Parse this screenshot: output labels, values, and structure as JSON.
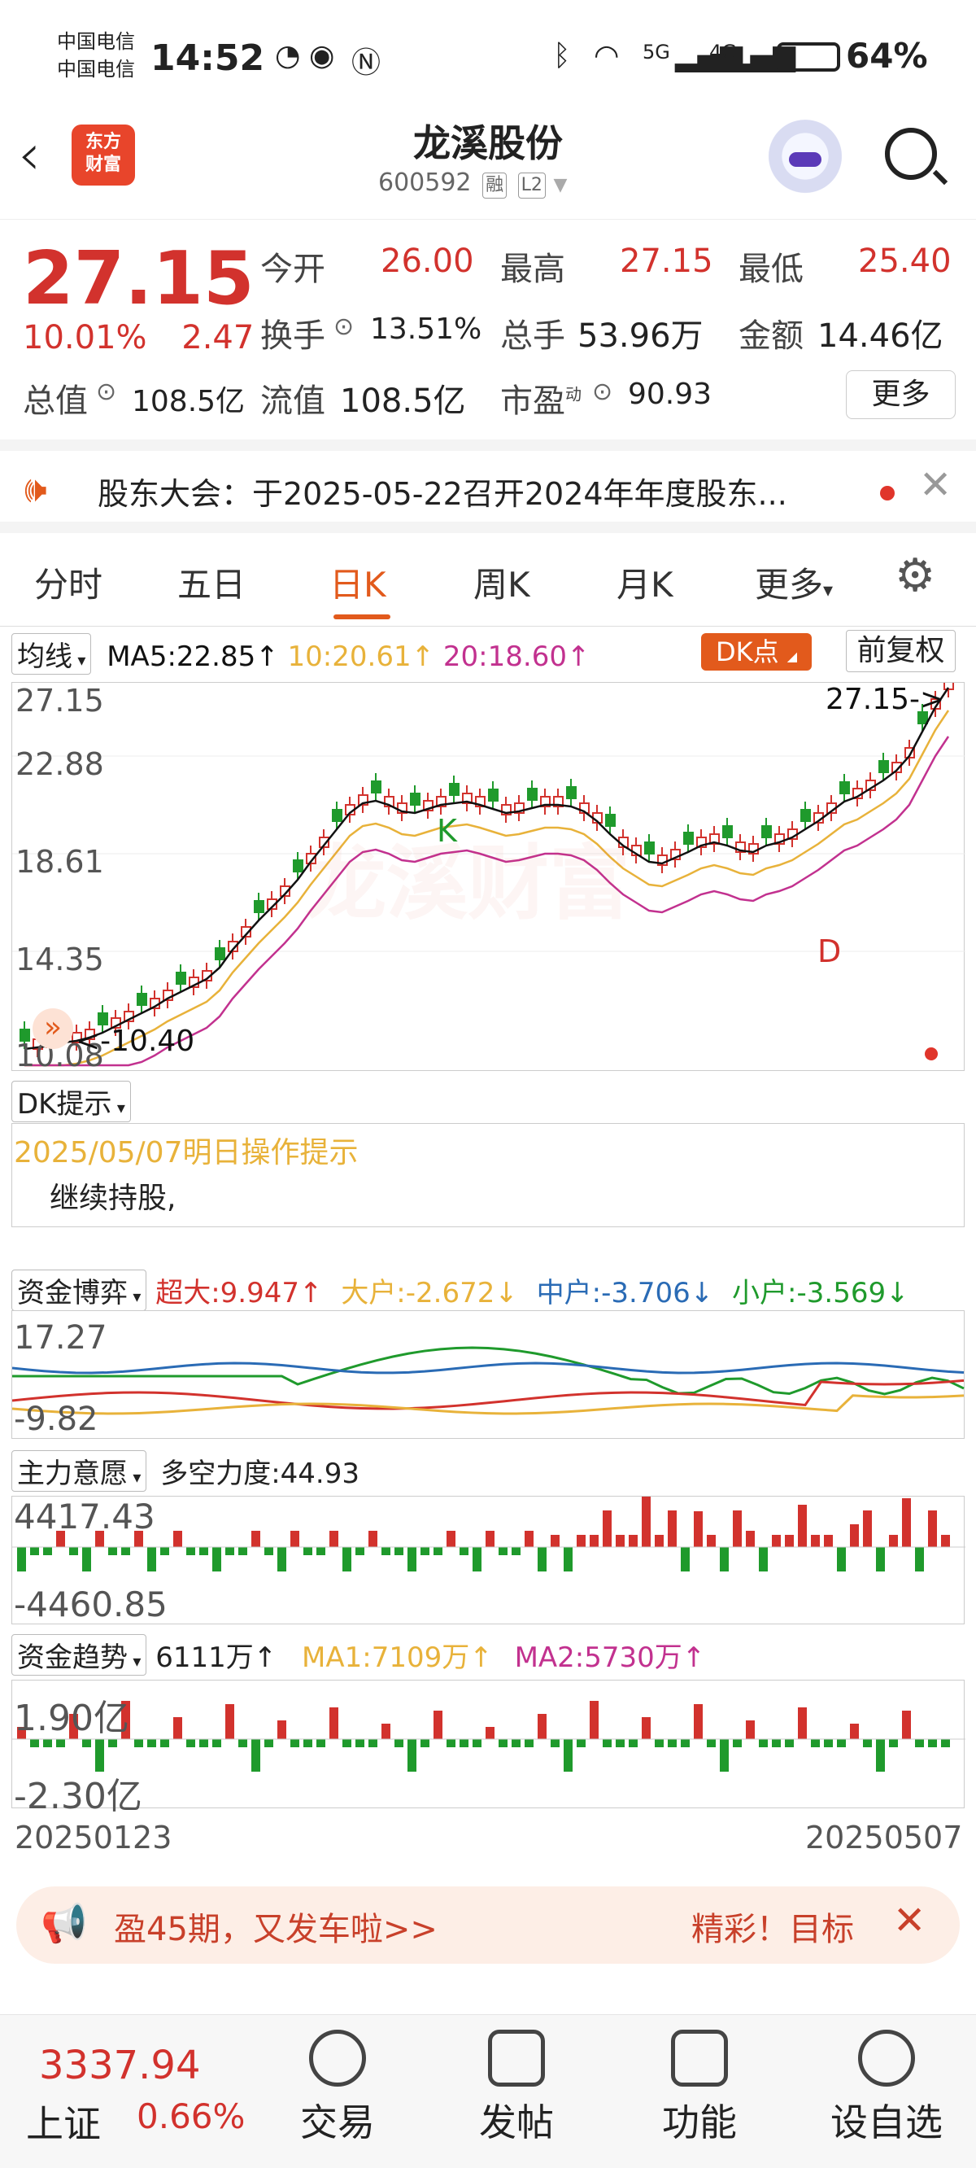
{
  "status_bar": {
    "carrier1": "中国电信",
    "carrier2": "中国电信",
    "time": "14:52",
    "battery": "64%",
    "signal1": "5G",
    "signal2": "4G"
  },
  "header": {
    "back_icon": "back-chevron-icon",
    "logo_line1": "东方",
    "logo_line2": "财富",
    "stock_name": "龙溪股份",
    "stock_code": "600592",
    "tag_margin": "融",
    "tag_level": "L2",
    "search_icon": "search-icon"
  },
  "quote": {
    "price": "27.15",
    "change_pct": "10.01%",
    "change_amt": "2.47",
    "open_label": "今开",
    "open_value": "26.00",
    "high_label": "最高",
    "high_value": "27.15",
    "low_label": "最低",
    "low_value": "25.40",
    "turnover_label": "换手",
    "turnover_value": "13.51%",
    "volume_label": "总手",
    "volume_value": "53.96万",
    "amount_label": "金额",
    "amount_value": "14.46亿",
    "total_cap_label": "总值",
    "total_cap_value": "108.5亿",
    "float_cap_label": "流值",
    "float_cap_value": "108.5亿",
    "pe_label": "市盈",
    "pe_sup": "动",
    "pe_value": "90.93",
    "more_label": "更多"
  },
  "notice": {
    "text": "股东大会：于2025-05-22召开2024年年度股东..."
  },
  "tabs": {
    "items": [
      "分时",
      "五日",
      "日K",
      "周K",
      "月K",
      "更多"
    ],
    "active": "日K"
  },
  "kline": {
    "ma_selector": "均线",
    "ma5": "MA5:22.85↑",
    "ma10": "10:20.61↑",
    "ma20": "20:18.60↑",
    "dk_button": "DK点",
    "fq_button": "前复权",
    "y_ticks": [
      "27.15",
      "22.88",
      "18.61",
      "14.35",
      "10.08"
    ],
    "high_marker": "27.15->",
    "low_marker": "<-10.40",
    "k_marker": "K",
    "d_marker": "D",
    "watermark": "龙溪财富"
  },
  "dk_tip": {
    "selector": "DK提示",
    "date_line": "2025/05/07明日操作提示",
    "advice": "继续持股,"
  },
  "fund_game": {
    "selector": "资金博弈",
    "super_large": "超大:9.947↑",
    "large": "大户:-2.672↓",
    "medium": "中户:-3.706↓",
    "small": "小户:-3.569↓",
    "y_top": "17.27",
    "y_bottom": "-9.82"
  },
  "main_will": {
    "selector": "主力意愿",
    "force": "多空力度:44.93",
    "y_top": "4417.43",
    "y_bottom": "-4460.85"
  },
  "fund_trend": {
    "selector": "资金趋势",
    "value": "6111万↑",
    "ma1": "MA1:7109万↑",
    "ma2": "MA2:5730万↑",
    "y_top": "1.90亿",
    "y_bottom": "-2.30亿",
    "date_start": "20250123",
    "date_end": "20250507"
  },
  "promo": {
    "text": "盈45期，又发车啦>>",
    "right_text": "精彩！目标"
  },
  "bottom_nav": {
    "index_value": "3337.94",
    "index_name": "上证",
    "index_change": "0.66%",
    "items": [
      "交易",
      "发帖",
      "功能",
      "设自选"
    ]
  },
  "colors": {
    "up": "#d2322d",
    "down": "#1f9a2c",
    "accent": "#e25a1c",
    "ma5": "#111111",
    "ma10": "#e8b23a",
    "ma20": "#c2318f"
  }
}
